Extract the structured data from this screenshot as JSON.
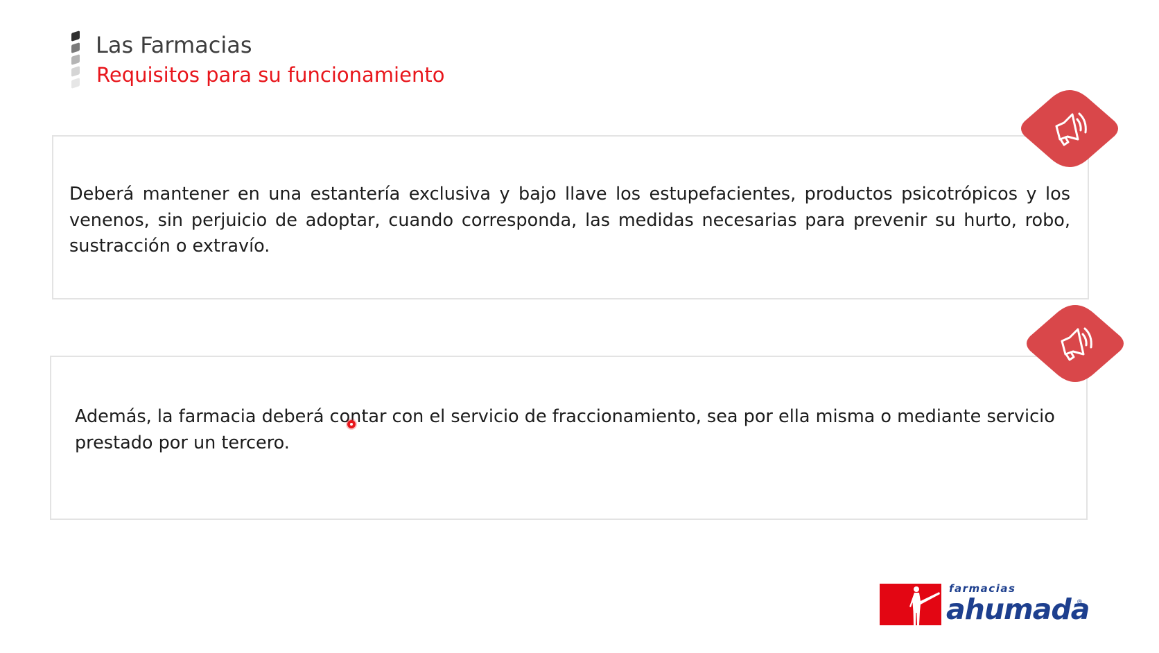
{
  "header": {
    "title": "Las Farmacias",
    "subtitle": "Requisitos para su funcionamiento"
  },
  "cards": [
    {
      "text": "Deberá mantener en una estantería exclusiva y bajo llave los estupefacientes, productos psicotrópicos y los venenos, sin perjuicio de adoptar, cuando corresponda, las medidas necesarias para prevenir su hurto, robo, sustracción o extravío.",
      "audio_icon": "speaker-icon"
    },
    {
      "text": "Además, la farmacia deberá contar con el servicio de fraccionamiento, sea por ella misma o mediante servicio prestado por un tercero.",
      "audio_icon": "speaker-icon"
    }
  ],
  "logo": {
    "top_text": "farmacias",
    "main_text": "ahumada",
    "registered": "®"
  },
  "colors": {
    "accent_red": "#e8151b",
    "audio_button": "#d9474a",
    "title_gray": "#3d3d3d",
    "text": "#1c1c1c",
    "card_border": "#e3e3e3",
    "logo_blue": "#1d3f8e",
    "logo_red": "#e30613",
    "bar_dark": "#2f2f2f",
    "bar_mid": "#7a7a7a",
    "bar_light": "#b5b5b5",
    "bar_lighter": "#d5d5d5"
  }
}
